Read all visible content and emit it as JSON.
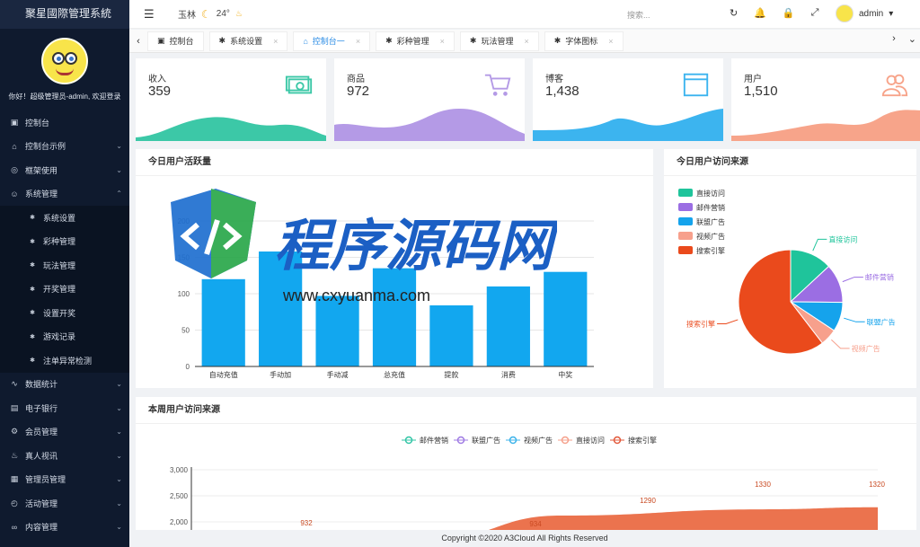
{
  "app": {
    "title": "聚星國際管理系統"
  },
  "sidebar": {
    "welcome": "你好！超级管理员-admin, 欢迎登录",
    "items": [
      {
        "label": "控制台",
        "icon": "dashboard-icon",
        "glyph": "▣",
        "caret": ""
      },
      {
        "label": "控制台示例",
        "icon": "home-icon",
        "glyph": "⌂",
        "caret": "⌄"
      },
      {
        "label": "框架使用",
        "icon": "framework-icon",
        "glyph": "◎",
        "caret": "⌄"
      },
      {
        "label": "系统管理",
        "icon": "user-icon",
        "glyph": "☺",
        "caret": "⌃"
      },
      {
        "label": "系统设置",
        "icon": "gear-icon",
        "glyph": "✱",
        "sub": true
      },
      {
        "label": "彩种管理",
        "icon": "gear-icon",
        "glyph": "✱",
        "sub": true
      },
      {
        "label": "玩法管理",
        "icon": "gear-icon",
        "glyph": "✱",
        "sub": true
      },
      {
        "label": "开奖管理",
        "icon": "gear-icon",
        "glyph": "✱",
        "sub": true
      },
      {
        "label": "设置开奖",
        "icon": "gear-icon",
        "glyph": "✱",
        "sub": true
      },
      {
        "label": "游戏记录",
        "icon": "gear-icon",
        "glyph": "✱",
        "sub": true
      },
      {
        "label": "注单异常检测",
        "icon": "gear-icon",
        "glyph": "✱",
        "sub": true
      },
      {
        "label": "数据统计",
        "icon": "chart-icon",
        "glyph": "∿",
        "caret": "⌄"
      },
      {
        "label": "电子银行",
        "icon": "bank-icon",
        "glyph": "▤",
        "caret": "⌄"
      },
      {
        "label": "会员管理",
        "icon": "member-icon",
        "glyph": "⚙",
        "caret": "⌄"
      },
      {
        "label": "真人视讯",
        "icon": "live-icon",
        "glyph": "♨",
        "caret": "⌄"
      },
      {
        "label": "管理员管理",
        "icon": "admin-icon",
        "glyph": "▦",
        "caret": "⌄"
      },
      {
        "label": "活动管理",
        "icon": "activity-icon",
        "glyph": "◴",
        "caret": "⌄"
      },
      {
        "label": "内容管理",
        "icon": "content-icon",
        "glyph": "∞",
        "caret": "⌄"
      }
    ]
  },
  "header": {
    "city": "玉林",
    "temp": "24°",
    "weather_icon": "moon-icon",
    "search_placeholder": "搜索...",
    "user": "admin",
    "user_caret": "▾"
  },
  "tabs": [
    {
      "label": "控制台",
      "icon": "dashboard-icon",
      "glyph": "▣",
      "closable": false,
      "active": false
    },
    {
      "label": "系统设置",
      "icon": "gear-icon",
      "glyph": "✱",
      "closable": true,
      "active": false
    },
    {
      "label": "控制台一",
      "icon": "home-icon",
      "glyph": "⌂",
      "closable": true,
      "active": true
    },
    {
      "label": "彩种管理",
      "icon": "gear-icon",
      "glyph": "✱",
      "closable": true,
      "active": false
    },
    {
      "label": "玩法管理",
      "icon": "gear-icon",
      "glyph": "✱",
      "closable": true,
      "active": false
    },
    {
      "label": "字体图标",
      "icon": "font-icon",
      "glyph": "✱",
      "closable": true,
      "active": false
    }
  ],
  "stats": [
    {
      "label": "收入",
      "value": "359",
      "icon": "money-icon",
      "color": "#3cc8a7"
    },
    {
      "label": "商品",
      "value": "972",
      "icon": "cart-icon",
      "color": "#b49ae6"
    },
    {
      "label": "博客",
      "value": "1,438",
      "icon": "browser-icon",
      "color": "#3cb4ef"
    },
    {
      "label": "用户",
      "value": "1,510",
      "icon": "users-icon",
      "color": "#f7a48a"
    }
  ],
  "panels": {
    "activity_title": "今日用户活跃量",
    "source_title": "今日用户访问来源",
    "weekly_title": "本周用户访问来源"
  },
  "chart_data": [
    {
      "type": "bar",
      "title": "今日用户活跃量",
      "categories": [
        "自动充值",
        "手动加",
        "手动减",
        "总充值",
        "提款",
        "消费",
        "中奖"
      ],
      "values": [
        120,
        158,
        97,
        135,
        84,
        110,
        130
      ],
      "ylim": [
        0,
        200
      ],
      "yticks": [
        0,
        50,
        100,
        150,
        200
      ],
      "color": "#12a7ef"
    },
    {
      "type": "pie",
      "title": "今日用户访问来源",
      "legend": [
        "直接访问",
        "邮件营销",
        "联盟广告",
        "视频广告",
        "搜索引擎"
      ],
      "values": [
        335,
        310,
        234,
        135,
        1548
      ],
      "colors": [
        "#1fc49b",
        "#9b6ee3",
        "#15a3ec",
        "#f7a08c",
        "#ea4a1c"
      ],
      "legend_position": "top-left"
    },
    {
      "type": "area",
      "title": "本周用户访问来源",
      "legend": [
        "邮件营销",
        "联盟广告",
        "视频广告",
        "直接访问",
        "搜索引擎"
      ],
      "legend_colors": [
        "#32c5a6",
        "#9f7be3",
        "#3cb3ea",
        "#f5a18c",
        "#e2593b"
      ],
      "yticks": [
        "2,000",
        "2,500",
        "3,000"
      ],
      "ylim": [
        2000,
        3000
      ],
      "search_engine": [
        {
          "x": 0,
          "y": 1500
        },
        {
          "x": 2,
          "y": 1700
        },
        {
          "x": 3,
          "y": 2120
        },
        {
          "x": 4,
          "y": 2240
        },
        {
          "x": 5,
          "y": 2280
        }
      ],
      "data_labels": [
        "932",
        "934",
        "1290",
        "1330",
        "1320"
      ]
    }
  ],
  "footer": {
    "text": "Copyright ©2020 A3Cloud All Rights Reserved"
  },
  "watermark": {
    "brand": "程序源码网",
    "url": "www.cxyuanma.com"
  }
}
